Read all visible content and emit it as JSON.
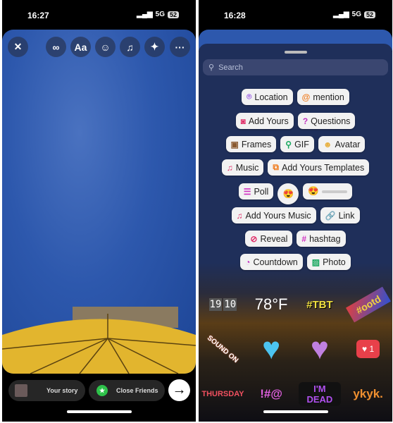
{
  "left": {
    "status": {
      "time": "16:27",
      "network": "5G",
      "battery": "52"
    },
    "toolbar": [
      {
        "icon": "close-icon",
        "glyph": "✕"
      },
      {
        "icon": "boomerang-icon",
        "glyph": "∞"
      },
      {
        "icon": "text-icon",
        "glyph": "Aa"
      },
      {
        "icon": "sticker-icon",
        "glyph": "☺"
      },
      {
        "icon": "music-icon",
        "glyph": "♫"
      },
      {
        "icon": "effects-icon",
        "glyph": "✦"
      },
      {
        "icon": "more-icon",
        "glyph": "···"
      }
    ],
    "share": {
      "your_story": "Your story",
      "close_friends": "Close Friends",
      "next_glyph": "→"
    }
  },
  "right": {
    "status": {
      "time": "16:28",
      "network": "5G",
      "battery": "52"
    },
    "search_placeholder": "Search",
    "stickers": [
      [
        {
          "label": "Location",
          "icon": "location-pin-icon",
          "glyph": "⌾",
          "color": "#9b5de5"
        },
        {
          "label": "mention",
          "icon": "mention-icon",
          "glyph": "@",
          "color": "#f07a1a"
        }
      ],
      [
        {
          "label": "Add Yours",
          "icon": "camera-icon",
          "glyph": "◙",
          "color": "#e0306a"
        },
        {
          "label": "Questions",
          "icon": "question-icon",
          "glyph": "?",
          "color": "#c030c0"
        }
      ],
      [
        {
          "label": "Frames",
          "icon": "frames-photo-icon",
          "glyph": "▣",
          "color": "#8a5a30"
        },
        {
          "label": "GIF",
          "icon": "search-gif-icon",
          "glyph": "⚲",
          "color": "#1aa860"
        },
        {
          "label": "Avatar",
          "icon": "avatar-icon",
          "glyph": "☻",
          "color": "#e8b040"
        }
      ],
      [
        {
          "label": "Music",
          "icon": "music-icon",
          "glyph": "♫",
          "color": "#e0306a"
        },
        {
          "label": "Add Yours Templates",
          "icon": "templates-icon",
          "glyph": "⧉",
          "color": "#f07a1a"
        }
      ],
      [
        {
          "label": "Poll",
          "icon": "poll-icon",
          "glyph": "☰",
          "color": "#d030c0"
        }
      ],
      [
        {
          "label": "Add Yours Music",
          "icon": "music-plus-icon",
          "glyph": "♫",
          "color": "#e0306a"
        },
        {
          "label": "Link",
          "icon": "link-icon",
          "glyph": "🔗",
          "color": "#2a90e0"
        }
      ],
      [
        {
          "label": "Reveal",
          "icon": "eye-off-icon",
          "glyph": "⊘",
          "color": "#e0306a"
        },
        {
          "label": "hashtag",
          "icon": "hashtag-icon",
          "glyph": "#",
          "color": "#d030c0"
        }
      ],
      [
        {
          "label": "Countdown",
          "icon": "countdown-icon",
          "glyph": "◔",
          "color": "#c030c0"
        },
        {
          "label": "Photo",
          "icon": "photo-icon",
          "glyph": "▨",
          "color": "#1aa860"
        }
      ]
    ],
    "emoji_glyph": "😍",
    "grid": {
      "clock": [
        "19",
        "10"
      ],
      "temp": "78°F",
      "tbt": "#TBT",
      "ootd": "#ootd",
      "sound_on": "SOUND ON",
      "like_count": "1",
      "thursday": "THURSDAY",
      "symbols": "!#@",
      "im_dead": "I'M DEAD",
      "ykyk": "ykyk."
    }
  }
}
